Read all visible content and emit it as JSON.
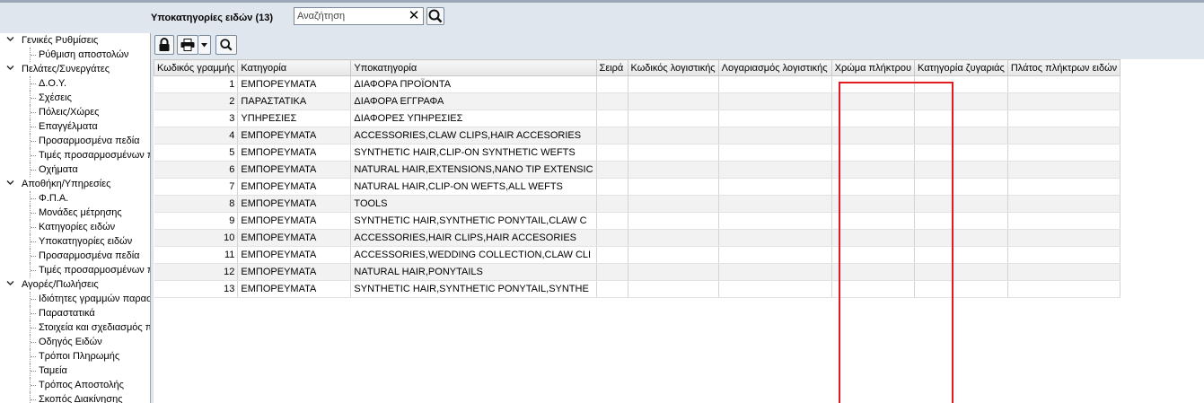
{
  "header": {
    "title": "Υποκατηγορίες ειδών (13)",
    "search_placeholder": "Αναζήτηση",
    "search_value": "",
    "clear_glyph": "✕"
  },
  "colors": {
    "highlight": "#e11b22",
    "header_bg": "#dfe6ee"
  },
  "sidebar": {
    "groups": [
      {
        "label": "Γενικές Ρυθμίσεις",
        "items": [
          "Ρύθμιση αποστολών"
        ]
      },
      {
        "label": "Πελάτες/Συνεργάτες",
        "items": [
          "Δ.Ο.Υ.",
          "Σχέσεις",
          "Πόλεις/Χώρες",
          "Επαγγέλματα",
          "Προσαρμοσμένα πεδία",
          "Τιμές προσαρμοσμένων π",
          "Οχήματα"
        ]
      },
      {
        "label": "Αποθήκη/Υπηρεσίες",
        "items": [
          "Φ.Π.Α.",
          "Μονάδες μέτρησης",
          "Κατηγορίες ειδών",
          "Υποκατηγορίες ειδών",
          "Προσαρμοσμένα πεδία",
          "Τιμές προσαρμοσμένων π"
        ]
      },
      {
        "label": "Αγορές/Πωλήσεις",
        "items": [
          "Ιδιότητες γραμμών παρασ",
          "Παραστατικά",
          "Στοιχεία και σχεδιασμός π",
          "Οδηγός Ειδών",
          "Τρόποι Πληρωμής",
          "Ταμεία",
          "Τρόπος Αποστολής",
          "Σκοπός Διακίνησης"
        ]
      }
    ]
  },
  "toolbar": {
    "icons": [
      "lock-icon",
      "printer-icon",
      "caret-down-icon",
      "search-icon"
    ]
  },
  "table": {
    "columns": [
      "Κωδικός γραμμής",
      "Κατηγορία",
      "Υποκατηγορία",
      "Σειρά",
      "Κωδικός λογιστικής",
      "Λογαριασμός λογιστικής",
      "Χρώμα πλήκτρου",
      "Κατηγορία ζυγαριάς",
      "Πλάτος πλήκτρων ειδών"
    ],
    "rows": [
      [
        "1",
        "ΕΜΠΟΡΕΥΜΑΤΑ",
        "ΔΙΑΦΟΡΑ ΠΡΟΪΟΝΤΑ",
        "",
        "",
        "",
        "",
        "",
        ""
      ],
      [
        "2",
        "ΠΑΡΑΣΤΑΤΙΚΑ",
        "ΔΙΑΦΟΡΑ ΕΓΓΡΑΦΑ",
        "",
        "",
        "",
        "",
        "",
        ""
      ],
      [
        "3",
        "ΥΠΗΡΕΣΙΕΣ",
        "ΔΙΑΦΟΡΕΣ ΥΠΗΡΕΣΙΕΣ",
        "",
        "",
        "",
        "",
        "",
        ""
      ],
      [
        "4",
        "ΕΜΠΟΡΕΥΜΑΤΑ",
        "ACCESSORIES,CLAW CLIPS,HAIR ACCESORIES",
        "",
        "",
        "",
        "",
        "",
        ""
      ],
      [
        "5",
        "ΕΜΠΟΡΕΥΜΑΤΑ",
        "SYNTHETIC HAIR,CLIP-ON SYNTHETIC WEFTS",
        "",
        "",
        "",
        "",
        "",
        ""
      ],
      [
        "6",
        "ΕΜΠΟΡΕΥΜΑΤΑ",
        "NATURAL HAIR,EXTENSIONS,NANO TIP EXTENSIC",
        "",
        "",
        "",
        "",
        "",
        ""
      ],
      [
        "7",
        "ΕΜΠΟΡΕΥΜΑΤΑ",
        "NATURAL HAIR,CLIP-ON WEFTS,ALL WEFTS",
        "",
        "",
        "",
        "",
        "",
        ""
      ],
      [
        "8",
        "ΕΜΠΟΡΕΥΜΑΤΑ",
        "TOOLS",
        "",
        "",
        "",
        "",
        "",
        ""
      ],
      [
        "9",
        "ΕΜΠΟΡΕΥΜΑΤΑ",
        "SYNTHETIC HAIR,SYNTHETIC PONYTAIL,CLAW C",
        "",
        "",
        "",
        "",
        "",
        ""
      ],
      [
        "10",
        "ΕΜΠΟΡΕΥΜΑΤΑ",
        "ACCESSORIES,HAIR CLIPS,HAIR ACCESORIES",
        "",
        "",
        "",
        "",
        "",
        ""
      ],
      [
        "11",
        "ΕΜΠΟΡΕΥΜΑΤΑ",
        "ACCESSORIES,WEDDING COLLECTION,CLAW CLI",
        "",
        "",
        "",
        "",
        "",
        ""
      ],
      [
        "12",
        "ΕΜΠΟΡΕΥΜΑΤΑ",
        "NATURAL HAIR,PONYTAILS",
        "",
        "",
        "",
        "",
        "",
        ""
      ],
      [
        "13",
        "ΕΜΠΟΡΕΥΜΑΤΑ",
        "SYNTHETIC HAIR,SYNTHETIC PONYTAIL,SYNTHE",
        "",
        "",
        "",
        "",
        "",
        ""
      ]
    ]
  }
}
